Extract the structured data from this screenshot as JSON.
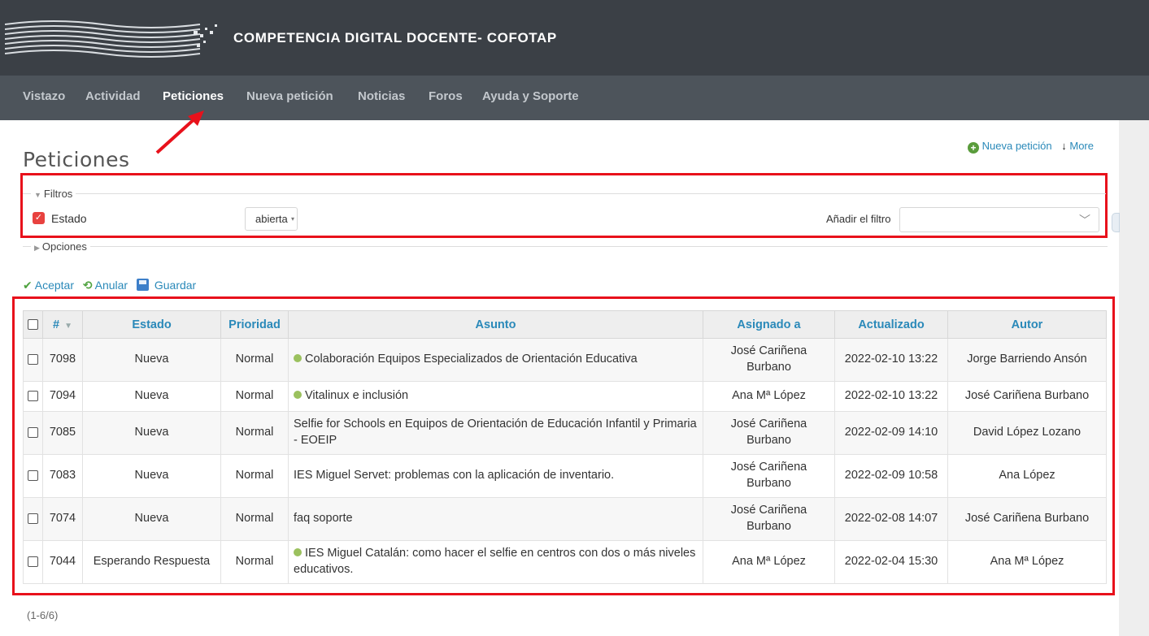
{
  "header": {
    "title": "COMPETENCIA DIGITAL DOCENTE- COFOTAP"
  },
  "nav": {
    "items": [
      {
        "label": "Vistazo"
      },
      {
        "label": "Actividad"
      },
      {
        "label": "Peticiones"
      },
      {
        "label": "Nueva petición"
      },
      {
        "label": "Noticias"
      },
      {
        "label": "Foros"
      },
      {
        "label": "Ayuda y Soporte"
      }
    ],
    "selected": "Peticiones"
  },
  "contextual": {
    "new_issue": "Nueva petición",
    "more": "More"
  },
  "page": {
    "title": "Peticiones"
  },
  "filters": {
    "legend": "Filtros",
    "status_label": "Estado",
    "status_value": "abierta",
    "add_filter_label": "Añadir el filtro",
    "add_filter_value": ""
  },
  "options": {
    "legend": "Opciones"
  },
  "query_buttons": {
    "apply": "Aceptar",
    "clear": "Anular",
    "save": "Guardar"
  },
  "table": {
    "headers": [
      "#",
      "Estado",
      "Prioridad",
      "Asunto",
      "Asignado a",
      "Actualizado",
      "Autor"
    ],
    "rows": [
      {
        "id": "7098",
        "status": "Nueva",
        "priority": "Normal",
        "subject": "Colaboración Equipos Especializados de Orientación Educativa",
        "dot": true,
        "assigned": "José Cariñena Burbano",
        "updated": "2022-02-10 13:22",
        "author": "Jorge Barriendo Ansón"
      },
      {
        "id": "7094",
        "status": "Nueva",
        "priority": "Normal",
        "subject": "Vitalinux e inclusión",
        "dot": true,
        "assigned": "Ana Mª López",
        "updated": "2022-02-10 13:22",
        "author": "José Cariñena Burbano"
      },
      {
        "id": "7085",
        "status": "Nueva",
        "priority": "Normal",
        "subject": "Selfie for Schools en Equipos de Orientación de Educación Infantil y Primaria - EOEIP",
        "dot": false,
        "assigned": "José Cariñena Burbano",
        "updated": "2022-02-09 14:10",
        "author": "David López Lozano"
      },
      {
        "id": "7083",
        "status": "Nueva",
        "priority": "Normal",
        "subject": "IES Miguel Servet: problemas con la aplicación de inventario.",
        "dot": false,
        "assigned": "José Cariñena Burbano",
        "updated": "2022-02-09 10:58",
        "author": "Ana López"
      },
      {
        "id": "7074",
        "status": "Nueva",
        "priority": "Normal",
        "subject": "faq soporte",
        "dot": false,
        "assigned": "José Cariñena Burbano",
        "updated": "2022-02-08 14:07",
        "author": "José Cariñena Burbano"
      },
      {
        "id": "7044",
        "status": "Esperando Respuesta",
        "priority": "Normal",
        "subject": "IES Miguel Catalán: como hacer el selfie en centros con dos o más niveles educativos.",
        "dot": true,
        "assigned": "Ana Mª López",
        "updated": "2022-02-04 15:30",
        "author": "Ana Mª López"
      }
    ]
  },
  "pagination": {
    "text": "(1-6/6)"
  },
  "colors": {
    "header_bg": "#3b4046",
    "nav_bg": "#4d545b",
    "link": "#2a89b9",
    "annotation_red": "#e8111b",
    "status_dot": "#9bc15e"
  }
}
